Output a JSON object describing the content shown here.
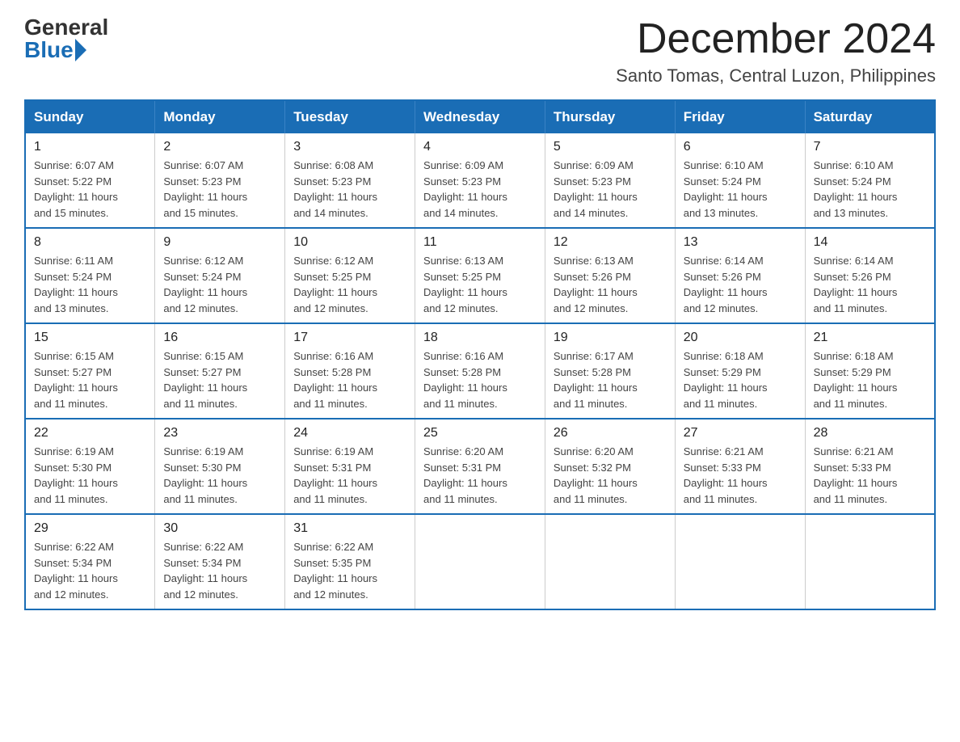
{
  "logo": {
    "general": "General",
    "blue": "Blue"
  },
  "header": {
    "month_title": "December 2024",
    "subtitle": "Santo Tomas, Central Luzon, Philippines"
  },
  "weekdays": [
    "Sunday",
    "Monday",
    "Tuesday",
    "Wednesday",
    "Thursday",
    "Friday",
    "Saturday"
  ],
  "weeks": [
    [
      {
        "day": "1",
        "sunrise": "6:07 AM",
        "sunset": "5:22 PM",
        "daylight": "11 hours and 15 minutes."
      },
      {
        "day": "2",
        "sunrise": "6:07 AM",
        "sunset": "5:23 PM",
        "daylight": "11 hours and 15 minutes."
      },
      {
        "day": "3",
        "sunrise": "6:08 AM",
        "sunset": "5:23 PM",
        "daylight": "11 hours and 14 minutes."
      },
      {
        "day": "4",
        "sunrise": "6:09 AM",
        "sunset": "5:23 PM",
        "daylight": "11 hours and 14 minutes."
      },
      {
        "day": "5",
        "sunrise": "6:09 AM",
        "sunset": "5:23 PM",
        "daylight": "11 hours and 14 minutes."
      },
      {
        "day": "6",
        "sunrise": "6:10 AM",
        "sunset": "5:24 PM",
        "daylight": "11 hours and 13 minutes."
      },
      {
        "day": "7",
        "sunrise": "6:10 AM",
        "sunset": "5:24 PM",
        "daylight": "11 hours and 13 minutes."
      }
    ],
    [
      {
        "day": "8",
        "sunrise": "6:11 AM",
        "sunset": "5:24 PM",
        "daylight": "11 hours and 13 minutes."
      },
      {
        "day": "9",
        "sunrise": "6:12 AM",
        "sunset": "5:24 PM",
        "daylight": "11 hours and 12 minutes."
      },
      {
        "day": "10",
        "sunrise": "6:12 AM",
        "sunset": "5:25 PM",
        "daylight": "11 hours and 12 minutes."
      },
      {
        "day": "11",
        "sunrise": "6:13 AM",
        "sunset": "5:25 PM",
        "daylight": "11 hours and 12 minutes."
      },
      {
        "day": "12",
        "sunrise": "6:13 AM",
        "sunset": "5:26 PM",
        "daylight": "11 hours and 12 minutes."
      },
      {
        "day": "13",
        "sunrise": "6:14 AM",
        "sunset": "5:26 PM",
        "daylight": "11 hours and 12 minutes."
      },
      {
        "day": "14",
        "sunrise": "6:14 AM",
        "sunset": "5:26 PM",
        "daylight": "11 hours and 11 minutes."
      }
    ],
    [
      {
        "day": "15",
        "sunrise": "6:15 AM",
        "sunset": "5:27 PM",
        "daylight": "11 hours and 11 minutes."
      },
      {
        "day": "16",
        "sunrise": "6:15 AM",
        "sunset": "5:27 PM",
        "daylight": "11 hours and 11 minutes."
      },
      {
        "day": "17",
        "sunrise": "6:16 AM",
        "sunset": "5:28 PM",
        "daylight": "11 hours and 11 minutes."
      },
      {
        "day": "18",
        "sunrise": "6:16 AM",
        "sunset": "5:28 PM",
        "daylight": "11 hours and 11 minutes."
      },
      {
        "day": "19",
        "sunrise": "6:17 AM",
        "sunset": "5:28 PM",
        "daylight": "11 hours and 11 minutes."
      },
      {
        "day": "20",
        "sunrise": "6:18 AM",
        "sunset": "5:29 PM",
        "daylight": "11 hours and 11 minutes."
      },
      {
        "day": "21",
        "sunrise": "6:18 AM",
        "sunset": "5:29 PM",
        "daylight": "11 hours and 11 minutes."
      }
    ],
    [
      {
        "day": "22",
        "sunrise": "6:19 AM",
        "sunset": "5:30 PM",
        "daylight": "11 hours and 11 minutes."
      },
      {
        "day": "23",
        "sunrise": "6:19 AM",
        "sunset": "5:30 PM",
        "daylight": "11 hours and 11 minutes."
      },
      {
        "day": "24",
        "sunrise": "6:19 AM",
        "sunset": "5:31 PM",
        "daylight": "11 hours and 11 minutes."
      },
      {
        "day": "25",
        "sunrise": "6:20 AM",
        "sunset": "5:31 PM",
        "daylight": "11 hours and 11 minutes."
      },
      {
        "day": "26",
        "sunrise": "6:20 AM",
        "sunset": "5:32 PM",
        "daylight": "11 hours and 11 minutes."
      },
      {
        "day": "27",
        "sunrise": "6:21 AM",
        "sunset": "5:33 PM",
        "daylight": "11 hours and 11 minutes."
      },
      {
        "day": "28",
        "sunrise": "6:21 AM",
        "sunset": "5:33 PM",
        "daylight": "11 hours and 11 minutes."
      }
    ],
    [
      {
        "day": "29",
        "sunrise": "6:22 AM",
        "sunset": "5:34 PM",
        "daylight": "11 hours and 12 minutes."
      },
      {
        "day": "30",
        "sunrise": "6:22 AM",
        "sunset": "5:34 PM",
        "daylight": "11 hours and 12 minutes."
      },
      {
        "day": "31",
        "sunrise": "6:22 AM",
        "sunset": "5:35 PM",
        "daylight": "11 hours and 12 minutes."
      },
      null,
      null,
      null,
      null
    ]
  ],
  "labels": {
    "sunrise": "Sunrise:",
    "sunset": "Sunset:",
    "daylight": "Daylight:"
  }
}
